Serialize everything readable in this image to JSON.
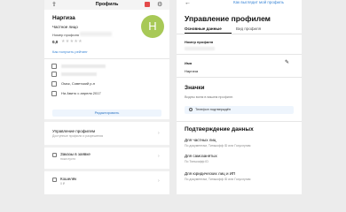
{
  "left": {
    "header_title": "Профиль",
    "share_icon": "share-icon",
    "name": "Наргиза",
    "account_type": "Частное лицо",
    "profile_number_label": "Номер профиля",
    "rating": "0,0",
    "stars": "★★★★★",
    "how_rating_link": "Как получить рейтинг",
    "avatar_letter": "H",
    "avatar_color": "#a8c957",
    "location": "Омск, Советский р-н",
    "since": "На Авито с апреля 2017",
    "edit_button": "Редактировать",
    "menu": [
      {
        "title": "Управление профилем",
        "subtitle": "Доступные профили и разрешения"
      },
      {
        "title": "Заказы в заявке",
        "subtitle": "пока пусто"
      },
      {
        "title": "Кошелёк",
        "subtitle": "0 ₽"
      }
    ]
  },
  "right": {
    "back_link": "Как выглядит мой профиль",
    "title": "Управление профилем",
    "tabs": [
      "Основные данные",
      "Вид профиля"
    ],
    "profile_number_label": "Номер профиля",
    "name_label": "Имя",
    "name_value": "Наргиза",
    "badges_title": "Значки",
    "badges_desc": "Видны всем в вашем профиле.",
    "phone_badge": "Телефон подтверждён",
    "verify_title": "Подтверждение данных",
    "verify_items": [
      {
        "title": "Для частных лиц",
        "subtitle": "По документам, Тинькофф ID или Госуслугам"
      },
      {
        "title": "Для самозанятых",
        "subtitle": "По Тинькофф ID"
      },
      {
        "title": "Для юридических лиц и ИП",
        "subtitle": "По документам, Тинькофф ID или Госуслугам"
      }
    ],
    "accent_color": "#3b86d6"
  }
}
